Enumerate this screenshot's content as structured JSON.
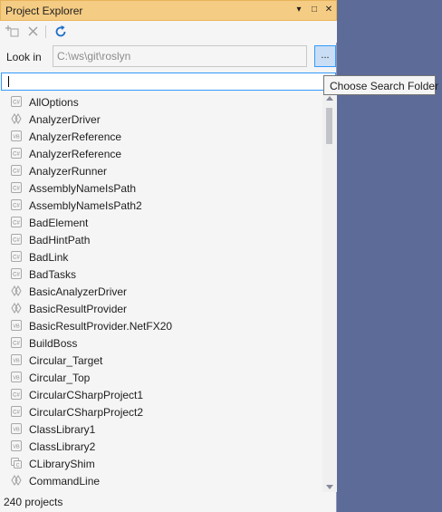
{
  "window": {
    "title": "Project Explorer",
    "menu_glyph": "▾",
    "maximize_glyph": "□",
    "close_glyph": "✕"
  },
  "toolbar": {
    "icons": [
      "add-project-icon",
      "remove-icon",
      "refresh-icon"
    ]
  },
  "look_in": {
    "label": "Look in",
    "value": "C:\\ws\\git\\roslyn",
    "browse_label": "..."
  },
  "search": {
    "value": ""
  },
  "tooltip": {
    "text": "Choose Search Folder"
  },
  "projects": [
    {
      "name": "AllOptions",
      "type": "csharp"
    },
    {
      "name": "AnalyzerDriver",
      "type": "shared"
    },
    {
      "name": "AnalyzerReference",
      "type": "vb"
    },
    {
      "name": "AnalyzerReference",
      "type": "csharp"
    },
    {
      "name": "AnalyzerRunner",
      "type": "csharp"
    },
    {
      "name": "AssemblyNameIsPath",
      "type": "csharp"
    },
    {
      "name": "AssemblyNameIsPath2",
      "type": "csharp"
    },
    {
      "name": "BadElement",
      "type": "csharp"
    },
    {
      "name": "BadHintPath",
      "type": "csharp"
    },
    {
      "name": "BadLink",
      "type": "csharp"
    },
    {
      "name": "BadTasks",
      "type": "csharp"
    },
    {
      "name": "BasicAnalyzerDriver",
      "type": "shared"
    },
    {
      "name": "BasicResultProvider",
      "type": "shared"
    },
    {
      "name": "BasicResultProvider.NetFX20",
      "type": "vb"
    },
    {
      "name": "BuildBoss",
      "type": "csharp"
    },
    {
      "name": "Circular_Target",
      "type": "vb"
    },
    {
      "name": "Circular_Top",
      "type": "vb"
    },
    {
      "name": "CircularCSharpProject1",
      "type": "csharp"
    },
    {
      "name": "CircularCSharpProject2",
      "type": "csharp"
    },
    {
      "name": "ClassLibrary1",
      "type": "vb"
    },
    {
      "name": "ClassLibrary2",
      "type": "vb"
    },
    {
      "name": "CLibraryShim",
      "type": "cpp"
    },
    {
      "name": "CommandLine",
      "type": "shared"
    }
  ],
  "status": {
    "text": "240 projects"
  },
  "colors": {
    "title_bar": "#f5cc84",
    "panel_bg": "#f5f5f5",
    "accent": "#3399ff",
    "background": "#5d6b99"
  }
}
